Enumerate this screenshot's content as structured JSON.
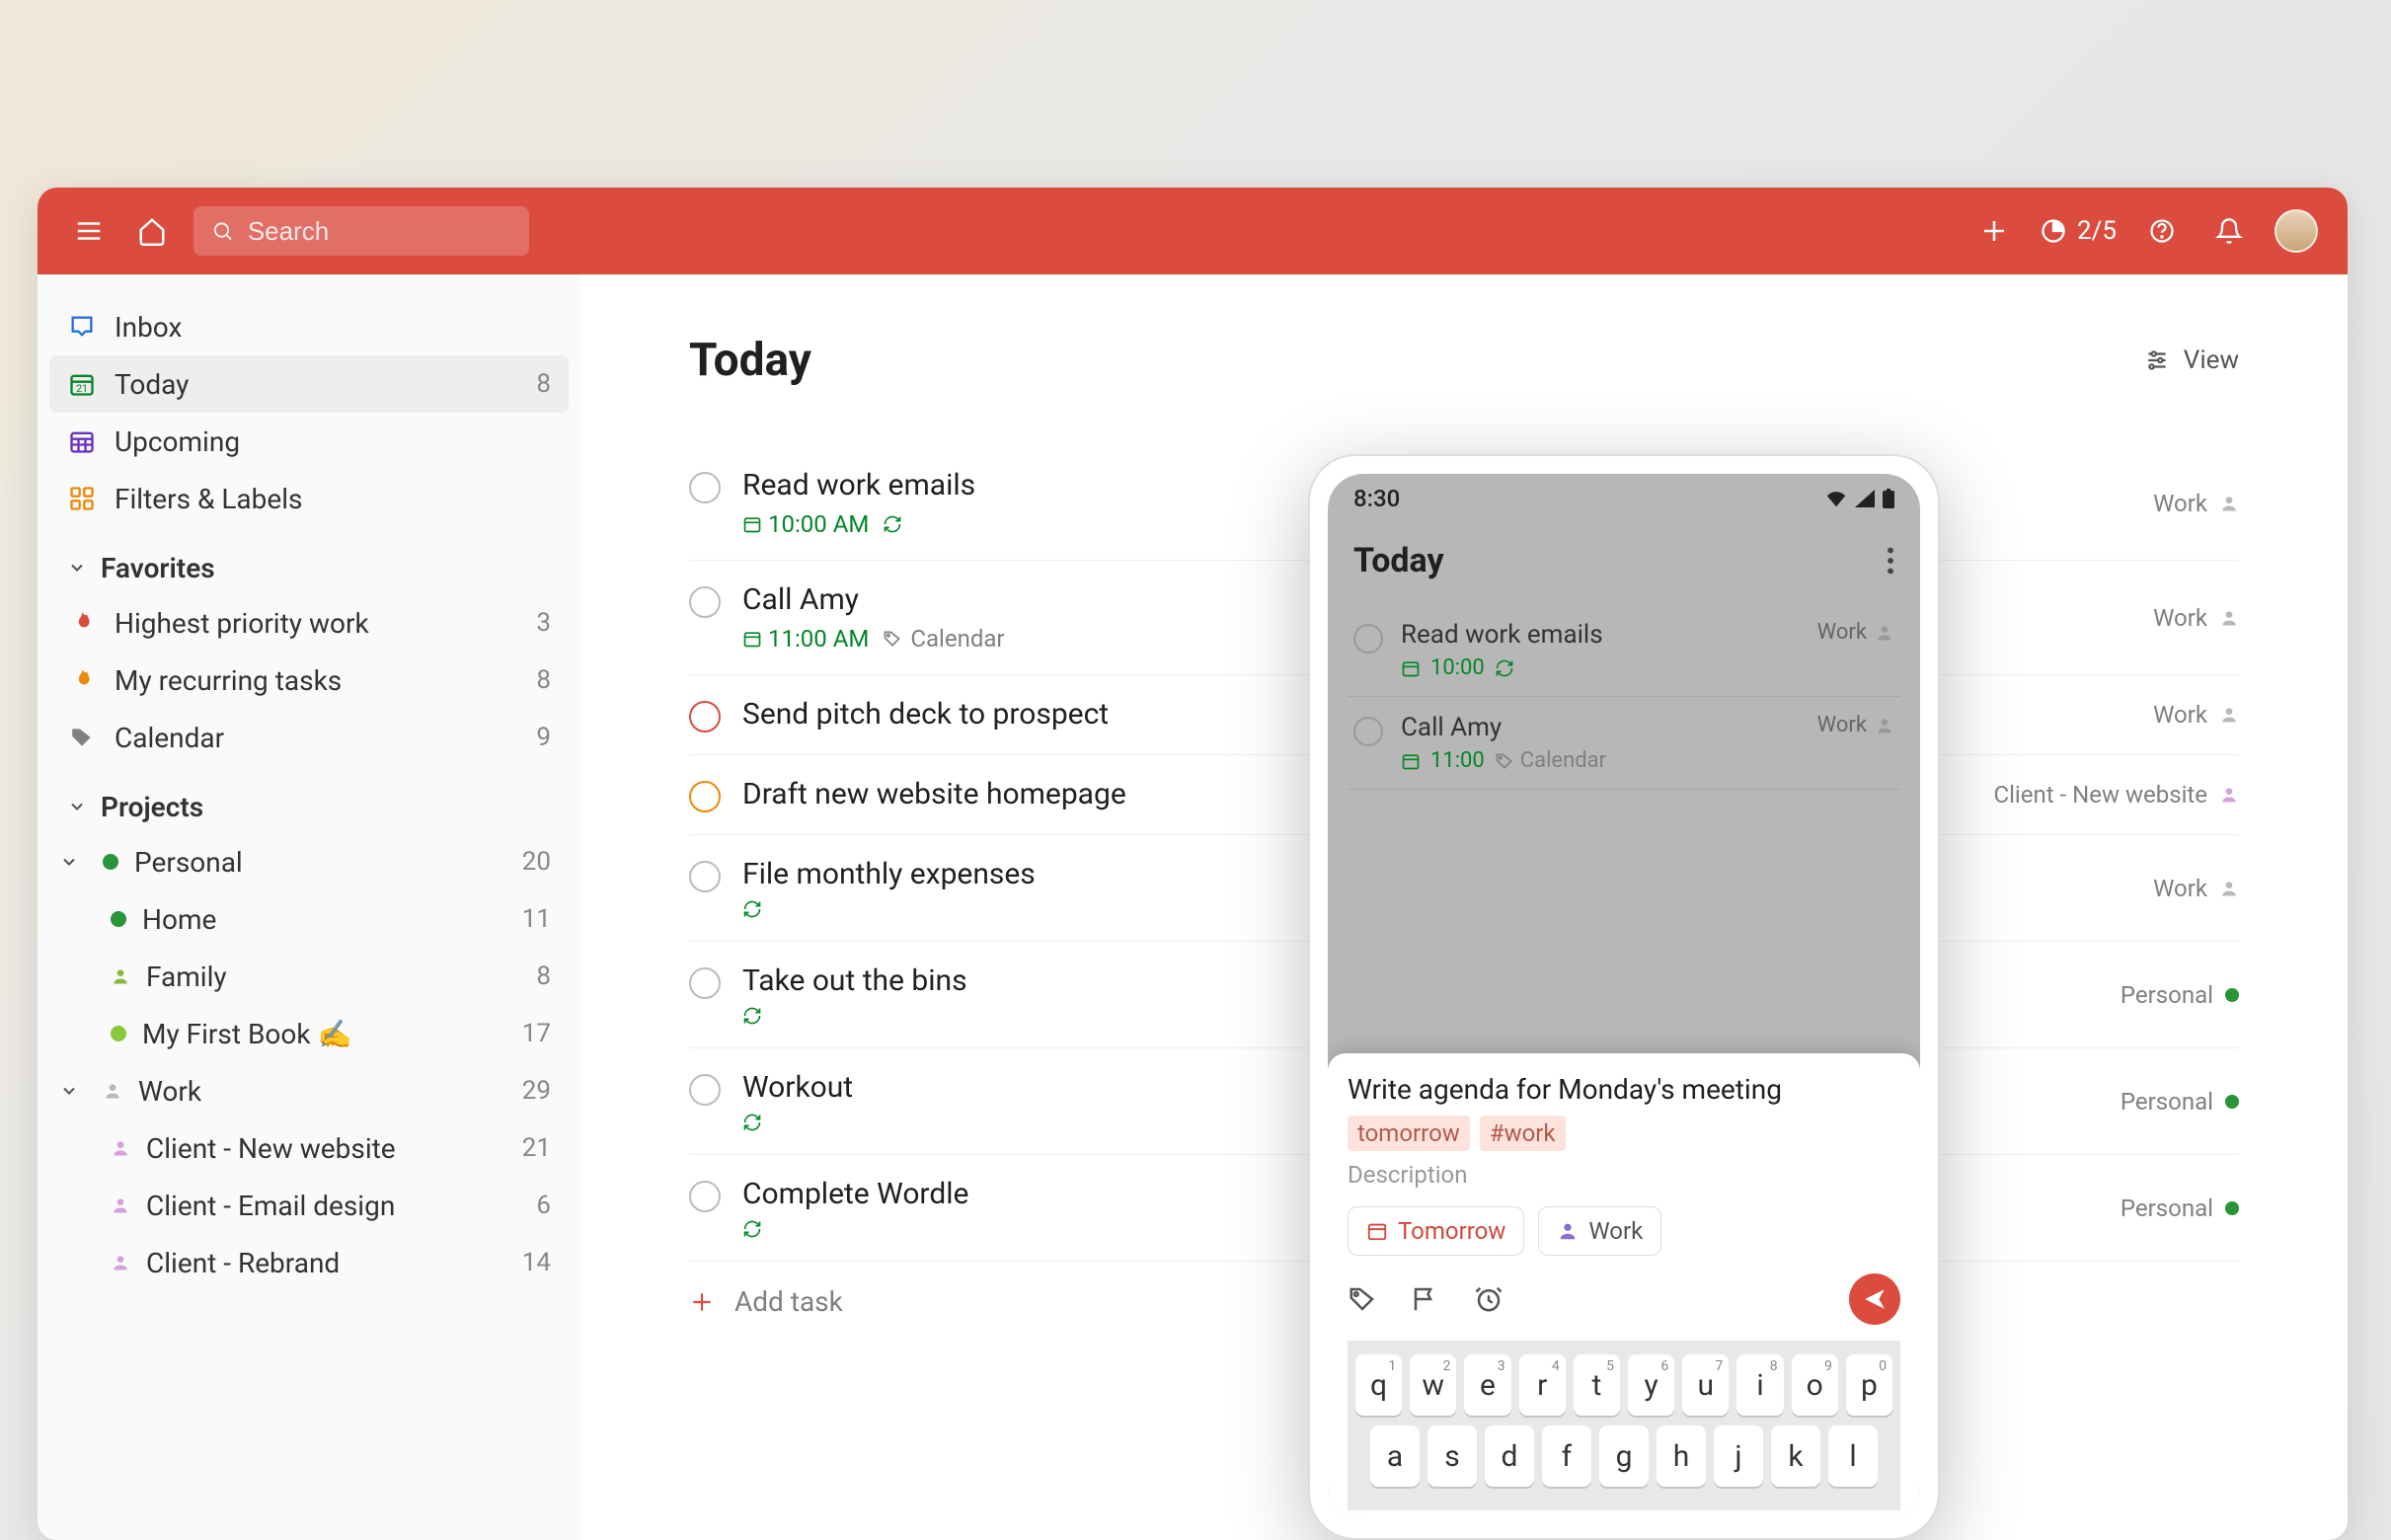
{
  "topbar": {
    "search_placeholder": "Search",
    "productivity_count": "2/5"
  },
  "sidebar": {
    "nav": [
      {
        "key": "inbox",
        "label": "Inbox",
        "count": null,
        "icon": "inbox",
        "color": "#246fe0"
      },
      {
        "key": "today",
        "label": "Today",
        "count": "8",
        "icon": "today",
        "color": "#058527",
        "active": true
      },
      {
        "key": "upcoming",
        "label": "Upcoming",
        "count": null,
        "icon": "upcoming",
        "color": "#692fc2"
      },
      {
        "key": "filters",
        "label": "Filters & Labels",
        "count": null,
        "icon": "filters",
        "color": "#eb8909"
      }
    ],
    "favorites_label": "Favorites",
    "favorites": [
      {
        "label": "Highest priority work",
        "count": "3",
        "icon": "flame",
        "color": "#db4c3f"
      },
      {
        "label": "My recurring tasks",
        "count": "8",
        "icon": "flame",
        "color": "#eb8909"
      },
      {
        "label": "Calendar",
        "count": "9",
        "icon": "tag",
        "color": "#808080"
      }
    ],
    "projects_label": "Projects",
    "projects": [
      {
        "label": "Personal",
        "count": "20",
        "color": "#299438",
        "type": "dot",
        "expanded": true,
        "children": [
          {
            "label": "Home",
            "count": "11",
            "color": "#299438",
            "type": "dot"
          },
          {
            "label": "Family",
            "count": "8",
            "color": "#87b93a",
            "type": "person"
          },
          {
            "label": "My First Book ✍️",
            "count": "17",
            "color": "#87c93a",
            "type": "dot"
          }
        ]
      },
      {
        "label": "Work",
        "count": "29",
        "color": "#b8b8b8",
        "type": "person",
        "expanded": true,
        "children": [
          {
            "label": "Client - New website",
            "count": "21",
            "color": "#d6a0dd",
            "type": "person"
          },
          {
            "label": "Client - Email design",
            "count": "6",
            "color": "#d6a0dd",
            "type": "person"
          },
          {
            "label": "Client - Rebrand",
            "count": "14",
            "color": "#d6a0dd",
            "type": "person"
          }
        ]
      }
    ]
  },
  "main": {
    "title": "Today",
    "view_label": "View",
    "add_task_label": "Add task",
    "tasks": [
      {
        "title": "Read work emails",
        "time": "10:00 AM",
        "recurring": true,
        "project": "Work",
        "project_color": "#b8b8b8",
        "project_icon": "person",
        "priority": ""
      },
      {
        "title": "Call Amy",
        "time": "11:00 AM",
        "calendar": "Calendar",
        "project": "Work",
        "project_color": "#b8b8b8",
        "project_icon": "person",
        "priority": ""
      },
      {
        "title": "Send pitch deck to prospect",
        "project": "Work",
        "project_color": "#b8b8b8",
        "project_icon": "person",
        "priority": "red"
      },
      {
        "title": "Draft new website homepage",
        "project": "Client - New website",
        "project_color": "#d6a0dd",
        "project_icon": "person",
        "priority": "orange"
      },
      {
        "title": "File monthly expenses",
        "recurring": true,
        "project": "Work",
        "project_color": "#b8b8b8",
        "project_icon": "person",
        "priority": ""
      },
      {
        "title": "Take out the bins",
        "recurring": true,
        "project": "Personal",
        "project_color": "#299438",
        "project_icon": "dot",
        "priority": ""
      },
      {
        "title": "Workout",
        "recurring": true,
        "project": "Personal",
        "project_color": "#299438",
        "project_icon": "dot",
        "priority": ""
      },
      {
        "title": "Complete Wordle",
        "recurring": true,
        "project": "Personal",
        "project_color": "#299438",
        "project_icon": "dot",
        "priority": ""
      }
    ]
  },
  "phone": {
    "status_time": "8:30",
    "title": "Today",
    "tasks": [
      {
        "title": "Read work emails",
        "time": "10:00",
        "recurring": true,
        "project": "Work"
      },
      {
        "title": "Call Amy",
        "time": "11:00",
        "calendar": "Calendar",
        "project": "Work"
      }
    ],
    "sheet": {
      "title": "Write agenda for Monday's meeting",
      "tag_date": "tomorrow",
      "tag_project": "#work",
      "description_placeholder": "Description",
      "chip_tomorrow": "Tomorrow",
      "chip_work": "Work"
    },
    "keyboard": {
      "row1": [
        "q",
        "w",
        "e",
        "r",
        "t",
        "y",
        "u",
        "i",
        "o",
        "p"
      ],
      "row1_nums": [
        "1",
        "2",
        "3",
        "4",
        "5",
        "6",
        "7",
        "8",
        "9",
        "0"
      ],
      "row2": [
        "a",
        "s",
        "d",
        "f",
        "g",
        "h",
        "j",
        "k",
        "l"
      ]
    }
  }
}
